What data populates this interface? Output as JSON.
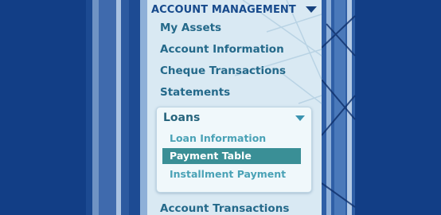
{
  "colors": {
    "background": "#123e86",
    "panel": "#d9e9f3",
    "header_text": "#174a8c",
    "menu_text": "#24698a",
    "sub_text": "#4aa2b6",
    "active_bg": "#3a8f96",
    "active_text": "#ffffff"
  },
  "nav": {
    "section_title": "ACCOUNT MANAGEMENT",
    "items": [
      {
        "label": "My Assets"
      },
      {
        "label": "Account Information"
      },
      {
        "label": "Cheque Transactions"
      },
      {
        "label": "Statements"
      }
    ],
    "loans": {
      "title": "Loans",
      "sub_items": [
        {
          "label": "Loan Information",
          "active": false
        },
        {
          "label": "Payment Table",
          "active": true
        },
        {
          "label": "Installment Payment",
          "active": false
        }
      ]
    },
    "after_items": [
      {
        "label": "Account Transactions"
      }
    ]
  },
  "icons": {
    "section_toggle": "chevron-down-icon",
    "loans_toggle": "chevron-down-icon"
  }
}
